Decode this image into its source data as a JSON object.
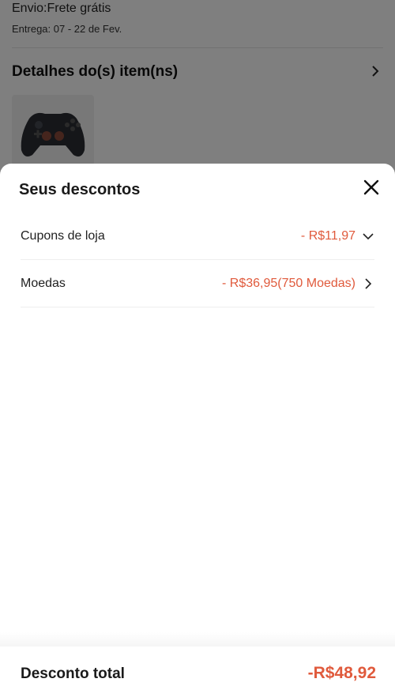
{
  "background": {
    "shipping": "Envio:Frete grátis",
    "delivery": "Entrega: 07 - 22 de Fev.",
    "details_title": "Detalhes do(s) item(ns)",
    "product_icon": "gamepad-controller"
  },
  "sheet": {
    "title": "Seus descontos",
    "close_icon": "close-x",
    "rows": [
      {
        "label": "Cupons de loja",
        "value": "- R$11,97",
        "icon": "chevron-down"
      },
      {
        "label": "Moedas",
        "value": "- R$36,95(750 Moedas)",
        "icon": "chevron-right"
      }
    ]
  },
  "footer": {
    "label": "Desconto total",
    "value": "-R$48,92"
  },
  "colors": {
    "accent": "#e05a3c",
    "overlay": "rgba(0,0,0,0.5)"
  }
}
